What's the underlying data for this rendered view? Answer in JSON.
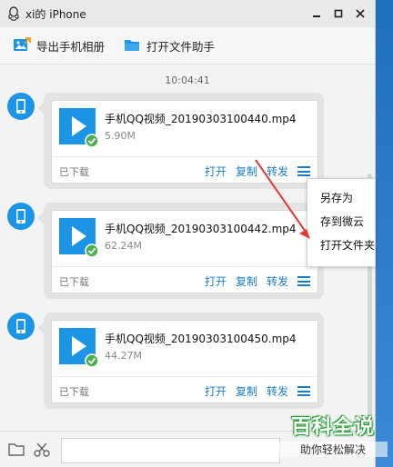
{
  "window": {
    "title": "xi的 iPhone"
  },
  "window_controls": {
    "minimize": "▬",
    "maximize": "■",
    "close": "✕"
  },
  "toolbar": {
    "export_album": "导出手机相册",
    "open_file_assistant": "打开文件助手"
  },
  "chat": {
    "timestamp": "10:04:41",
    "messages": [
      {
        "file_name": "手机QQ视频_20190303100440.mp4",
        "size": "5.90M",
        "status": "已下载",
        "open": "打开",
        "copy": "复制",
        "forward": "转发"
      },
      {
        "file_name": "手机QQ视频_20190303100442.mp4",
        "size": "62.24M",
        "status": "已下载",
        "open": "打开",
        "copy": "复制",
        "forward": "转发"
      },
      {
        "file_name": "手机QQ视频_20190303100450.mp4",
        "size": "44.27M",
        "status": "已下载",
        "open": "打开",
        "copy": "复制",
        "forward": "转发"
      }
    ]
  },
  "context_menu": {
    "items": [
      "另存为",
      "存到微云",
      "打开文件夹"
    ]
  },
  "watermark": {
    "title": "百科全说",
    "subtitle": "助你轻松解决"
  },
  "colors": {
    "accent": "#1a7cc9",
    "video_icon": "#1c95e6",
    "check": "#4caf50",
    "annotation_arrow": "#e53935"
  },
  "icons": [
    "qq-penguin-icon",
    "export-album-icon",
    "folder-icon",
    "phone-icon",
    "video-play-icon",
    "check-icon",
    "menu-icon",
    "scissors-icon"
  ]
}
